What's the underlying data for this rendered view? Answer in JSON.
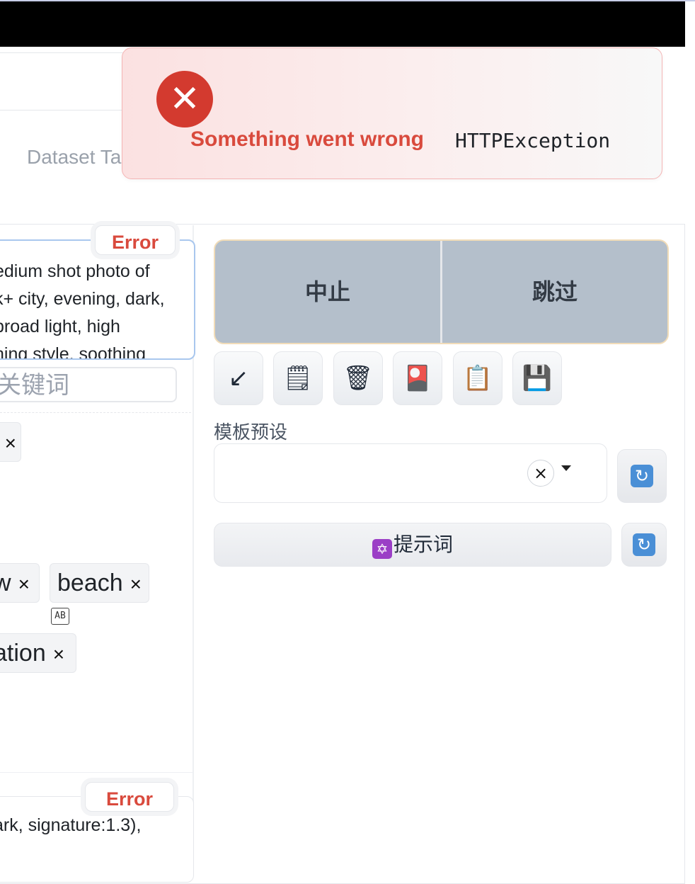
{
  "toast": {
    "title": "Something went wrong",
    "message": "HTTPException",
    "icon": "error-x-icon",
    "accent": "#d33a2f"
  },
  "tabs": {
    "visible_partial": "Dataset Ta"
  },
  "prompt_panel": {
    "error_badge": "Error",
    "prompt_lines": "edium shot photo of\nk+ city, evening, dark,\nbroad light, high\nning style, soothing",
    "keyword_placeholder": "f关键词",
    "tags": [
      {
        "label": "",
        "remove": "×"
      },
      {
        "label": "w",
        "remove": "×"
      },
      {
        "label": "beach",
        "remove": "×"
      },
      {
        "label": "ation",
        "remove": "×"
      }
    ],
    "negative_error_badge": "Error",
    "negative_text": "ark, signature:1.3),"
  },
  "controls": {
    "interrupt_label": "中止",
    "skip_label": "跳过",
    "tools": [
      {
        "name": "arrow-in-icon",
        "glyph": "↙"
      },
      {
        "name": "notepad-icon",
        "glyph": "🗒"
      },
      {
        "name": "trash-icon",
        "glyph": "🗑"
      },
      {
        "name": "flower-card-icon",
        "glyph": "🎴"
      },
      {
        "name": "clipboard-icon",
        "glyph": "📋"
      },
      {
        "name": "floppy-disk-icon",
        "glyph": "💾"
      }
    ],
    "preset_label": "模板预设",
    "preset_value": "",
    "clear_glyph": "×",
    "refresh_glyph": "🔄",
    "prompt_button_label": "提示词",
    "prompt_button_icon": "✡"
  }
}
